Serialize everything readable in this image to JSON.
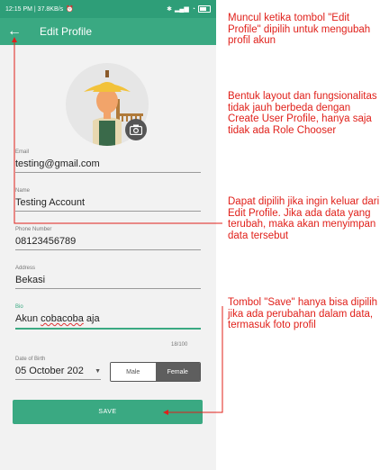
{
  "status_bar": {
    "time_info": "12:15 PM | 37.8KB/s"
  },
  "app_bar": {
    "title": "Edit Profile",
    "back_icon": "arrow-left-icon"
  },
  "form": {
    "email": {
      "label": "Email",
      "value": "testing@gmail.com"
    },
    "name": {
      "label": "Name",
      "value": "Testing Account"
    },
    "phone": {
      "label": "Phone Number",
      "value": "08123456789"
    },
    "address": {
      "label": "Address",
      "value": "Bekasi"
    },
    "bio": {
      "label": "Bio",
      "value_prefix": "Akun ",
      "value_underlined": "cobacoba",
      "value_suffix": " aja",
      "counter": "18/100"
    },
    "dob": {
      "label": "Date of Birth",
      "value": "05 October 202"
    },
    "gender": {
      "options": [
        "Male",
        "Female"
      ],
      "selected": "Female"
    },
    "save_label": "SAVE"
  },
  "annotations": {
    "a1": "Muncul ketika tombol \"Edit Profile\" dipilih untuk mengubah profil akun",
    "a2": "Bentuk layout dan fungsionalitas tidak jauh berbeda dengan Create User Profile, hanya saja tidak ada Role Chooser",
    "a3": "Dapat dipilih jika ingin keluar dari Edit Profile. Jika ada data yang terubah, maka akan menyimpan data tersebut",
    "a4": "Tombol \"Save\" hanya bisa dipilih jika ada perubahan dalam data, termasuk foto profil"
  },
  "colors": {
    "primary": "#3aa982",
    "status_bar": "#2e9e78",
    "annotation": "#e0201a"
  }
}
